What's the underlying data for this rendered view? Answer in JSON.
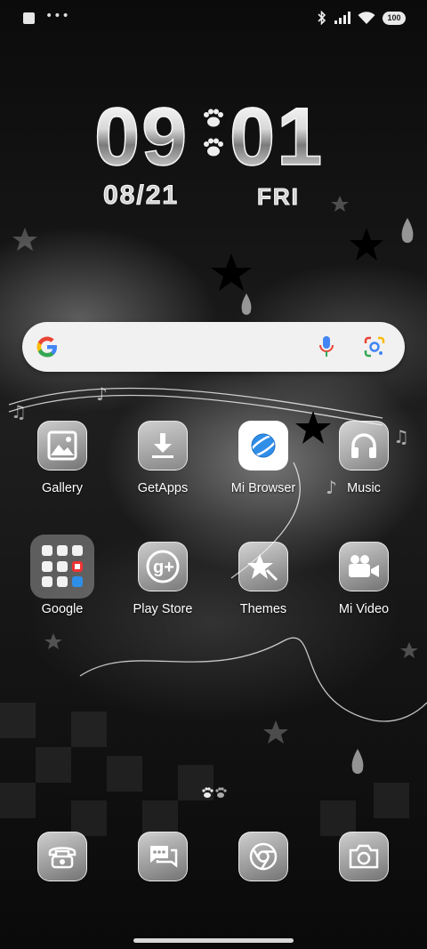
{
  "status_bar": {
    "left_icons": [
      "notification-square-icon",
      "more-dots-icon"
    ],
    "right_icons": [
      "bluetooth-icon",
      "signal-icon",
      "wifi-icon",
      "battery-icon"
    ],
    "battery_level": "100"
  },
  "clock": {
    "hours": "09",
    "minutes": "01",
    "date": "08/21",
    "weekday": "FRI"
  },
  "search": {
    "icons": [
      "google-g-icon",
      "microphone-icon",
      "google-lens-icon"
    ]
  },
  "apps": [
    {
      "label": "Gallery",
      "icon": "gallery-icon"
    },
    {
      "label": "GetApps",
      "icon": "download-icon"
    },
    {
      "label": "Mi Browser",
      "icon": "planet-icon"
    },
    {
      "label": "Music",
      "icon": "headphones-icon"
    },
    {
      "label": "Google",
      "icon": "folder-icon"
    },
    {
      "label": "Play Store",
      "icon": "google-plus-icon"
    },
    {
      "label": "Themes",
      "icon": "star-icon"
    },
    {
      "label": "Mi Video",
      "icon": "video-camera-icon"
    }
  ],
  "dock": [
    {
      "name": "phone",
      "icon": "phone-icon"
    },
    {
      "name": "messages",
      "icon": "chat-icon"
    },
    {
      "name": "chrome",
      "icon": "chrome-icon"
    },
    {
      "name": "camera",
      "icon": "camera-icon"
    }
  ],
  "colors": {
    "google_blue": "#4285F4",
    "google_red": "#EA4335",
    "google_yellow": "#FBBC05",
    "google_green": "#34A853",
    "browser_blue": "#2f8ee8"
  }
}
